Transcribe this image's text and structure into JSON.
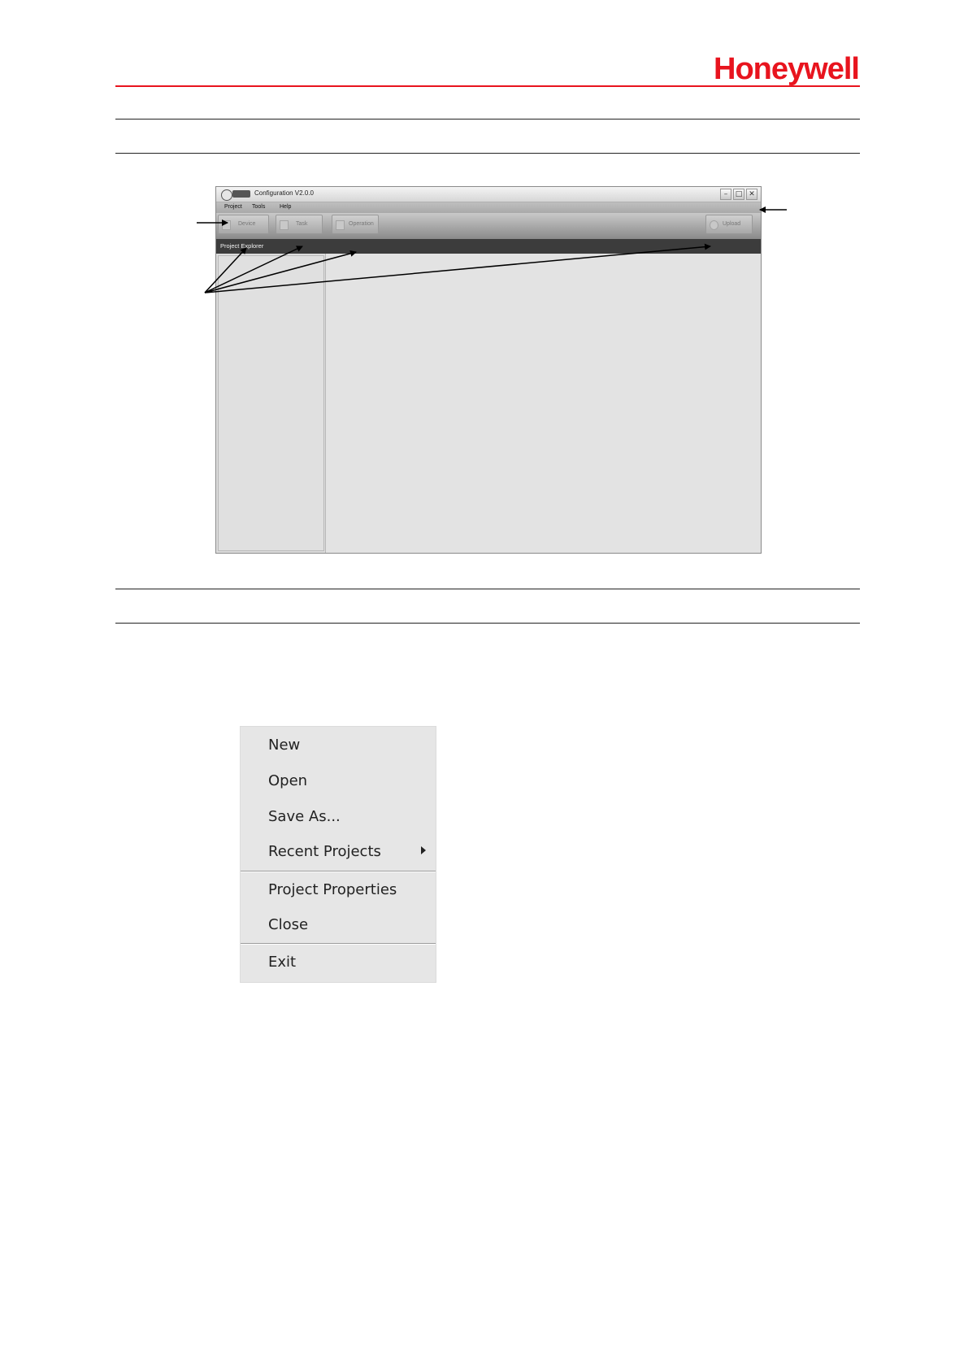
{
  "brand": {
    "logo_text": "Honeywell",
    "color": "#e8141e"
  },
  "window": {
    "title": "Configuration V2.0.0",
    "controls": {
      "minimize": "–",
      "maximize": "□",
      "close": "✕"
    },
    "menu": [
      "Project",
      "Tools",
      "Help"
    ],
    "toolbar": {
      "device": "Device",
      "task": "Task",
      "operation": "Operation",
      "upload": "Upload"
    },
    "panel_title": "Project Explorer"
  },
  "context_menu": {
    "items": [
      "New",
      "Open",
      "Save As...",
      "Recent Projects",
      "Project Properties",
      "Close",
      "Exit"
    ]
  }
}
